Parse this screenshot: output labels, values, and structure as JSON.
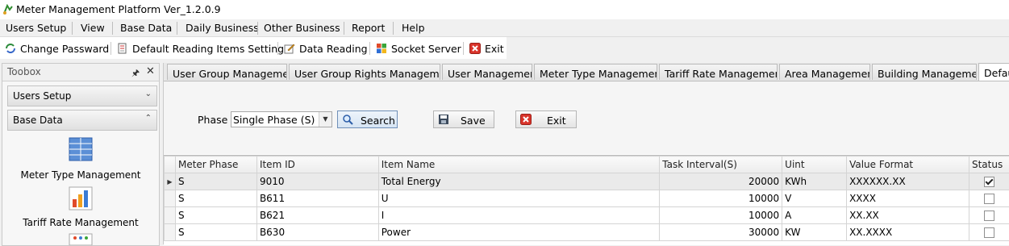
{
  "window": {
    "title": "Meter Management Platform Ver_1.2.0.9"
  },
  "menu": [
    "Users Setup",
    "View",
    "Base Data",
    "Daily Business",
    "Other Business",
    "Report",
    "Help"
  ],
  "toolbar": [
    "Change Passward",
    "Default Reading Items Setting",
    "Data Reading",
    "Socket Server",
    "Exit"
  ],
  "toolbox": {
    "title": "Toobox",
    "groups": [
      "Users Setup",
      "Base Data"
    ],
    "items": [
      "Meter Type Management",
      "Tariff Rate Management"
    ]
  },
  "tabs": [
    "User Group Management",
    "User Group Rights Management",
    "User Management",
    "Meter Type Management",
    "Tariff Rate Management",
    "Area Management",
    "Building Management",
    "Defau"
  ],
  "form": {
    "phase_label": "Phase",
    "phase_value": "Single Phase (S)",
    "search": "Search",
    "save": "Save",
    "exit": "Exit"
  },
  "grid": {
    "columns": [
      "Meter Phase",
      "Item ID",
      "Item Name",
      "Task Interval(S)",
      "Uint",
      "Value Format",
      "Status"
    ],
    "rows": [
      [
        "S",
        "9010",
        "Total Energy",
        "20000",
        "KWh",
        "XXXXXX.XX",
        true
      ],
      [
        "S",
        "B611",
        "U",
        "10000",
        "V",
        "XXXX",
        false
      ],
      [
        "S",
        "B621",
        "I",
        "10000",
        "A",
        "XX.XX",
        false
      ],
      [
        "S",
        "B630",
        "Power",
        "30000",
        "KW",
        "XX.XXXX",
        false
      ]
    ]
  },
  "colors": {
    "grid_line": "#d4d4d4",
    "selected_row": "#eaeaea",
    "exit_red": "#d9342b"
  }
}
